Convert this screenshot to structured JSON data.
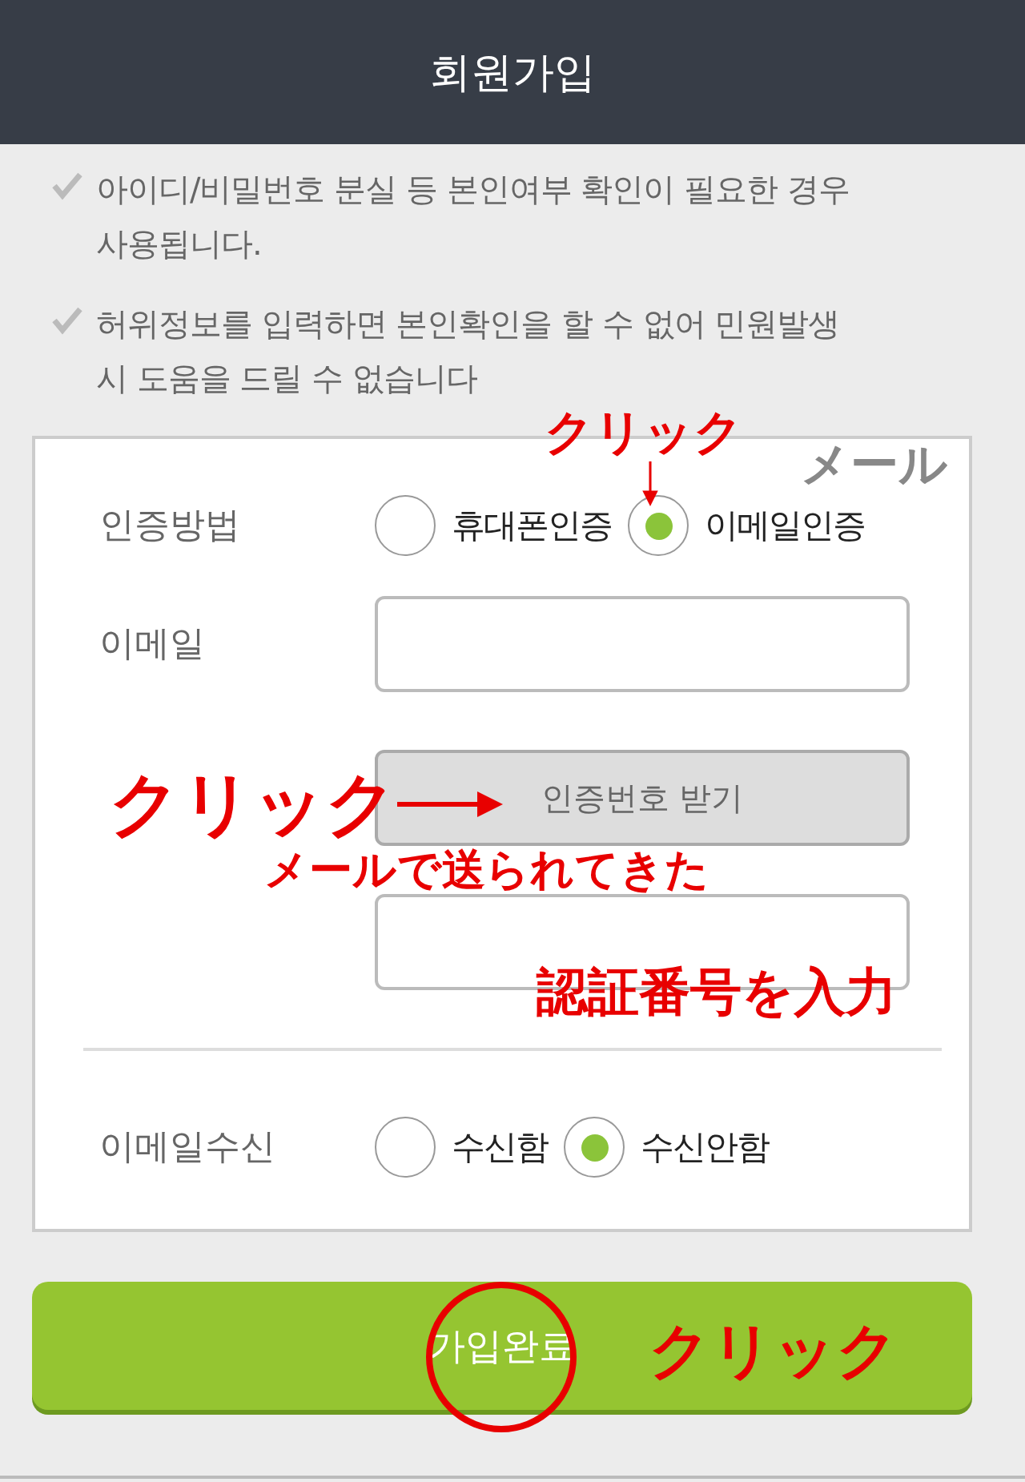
{
  "header": {
    "title": "회원가입"
  },
  "notes": [
    "아이디/비밀번호 분실 등 본인여부 확인이 필요한 경우 사용됩니다.",
    "허위정보를 입력하면 본인확인을 할 수 없어 민원발생 시 도움을 드릴 수 없습니다"
  ],
  "form": {
    "auth_method": {
      "label": "인증방법",
      "options": [
        {
          "label": "휴대폰인증",
          "selected": false
        },
        {
          "label": "이메일인증",
          "selected": true
        }
      ]
    },
    "email": {
      "label": "이메일"
    },
    "request_code_button": "인증번호 받기",
    "email_receive": {
      "label": "이메일수신",
      "options": [
        {
          "label": "수신함",
          "selected": false
        },
        {
          "label": "수신안함",
          "selected": true
        }
      ]
    }
  },
  "submit_button": "가입완료",
  "annotations": {
    "method_click": "クリック",
    "method_hint": "メール",
    "code_click": "クリック",
    "code_hint": [
      "メールで送られてきた",
      "認証番号を入力"
    ],
    "submit_click": "クリック"
  }
}
